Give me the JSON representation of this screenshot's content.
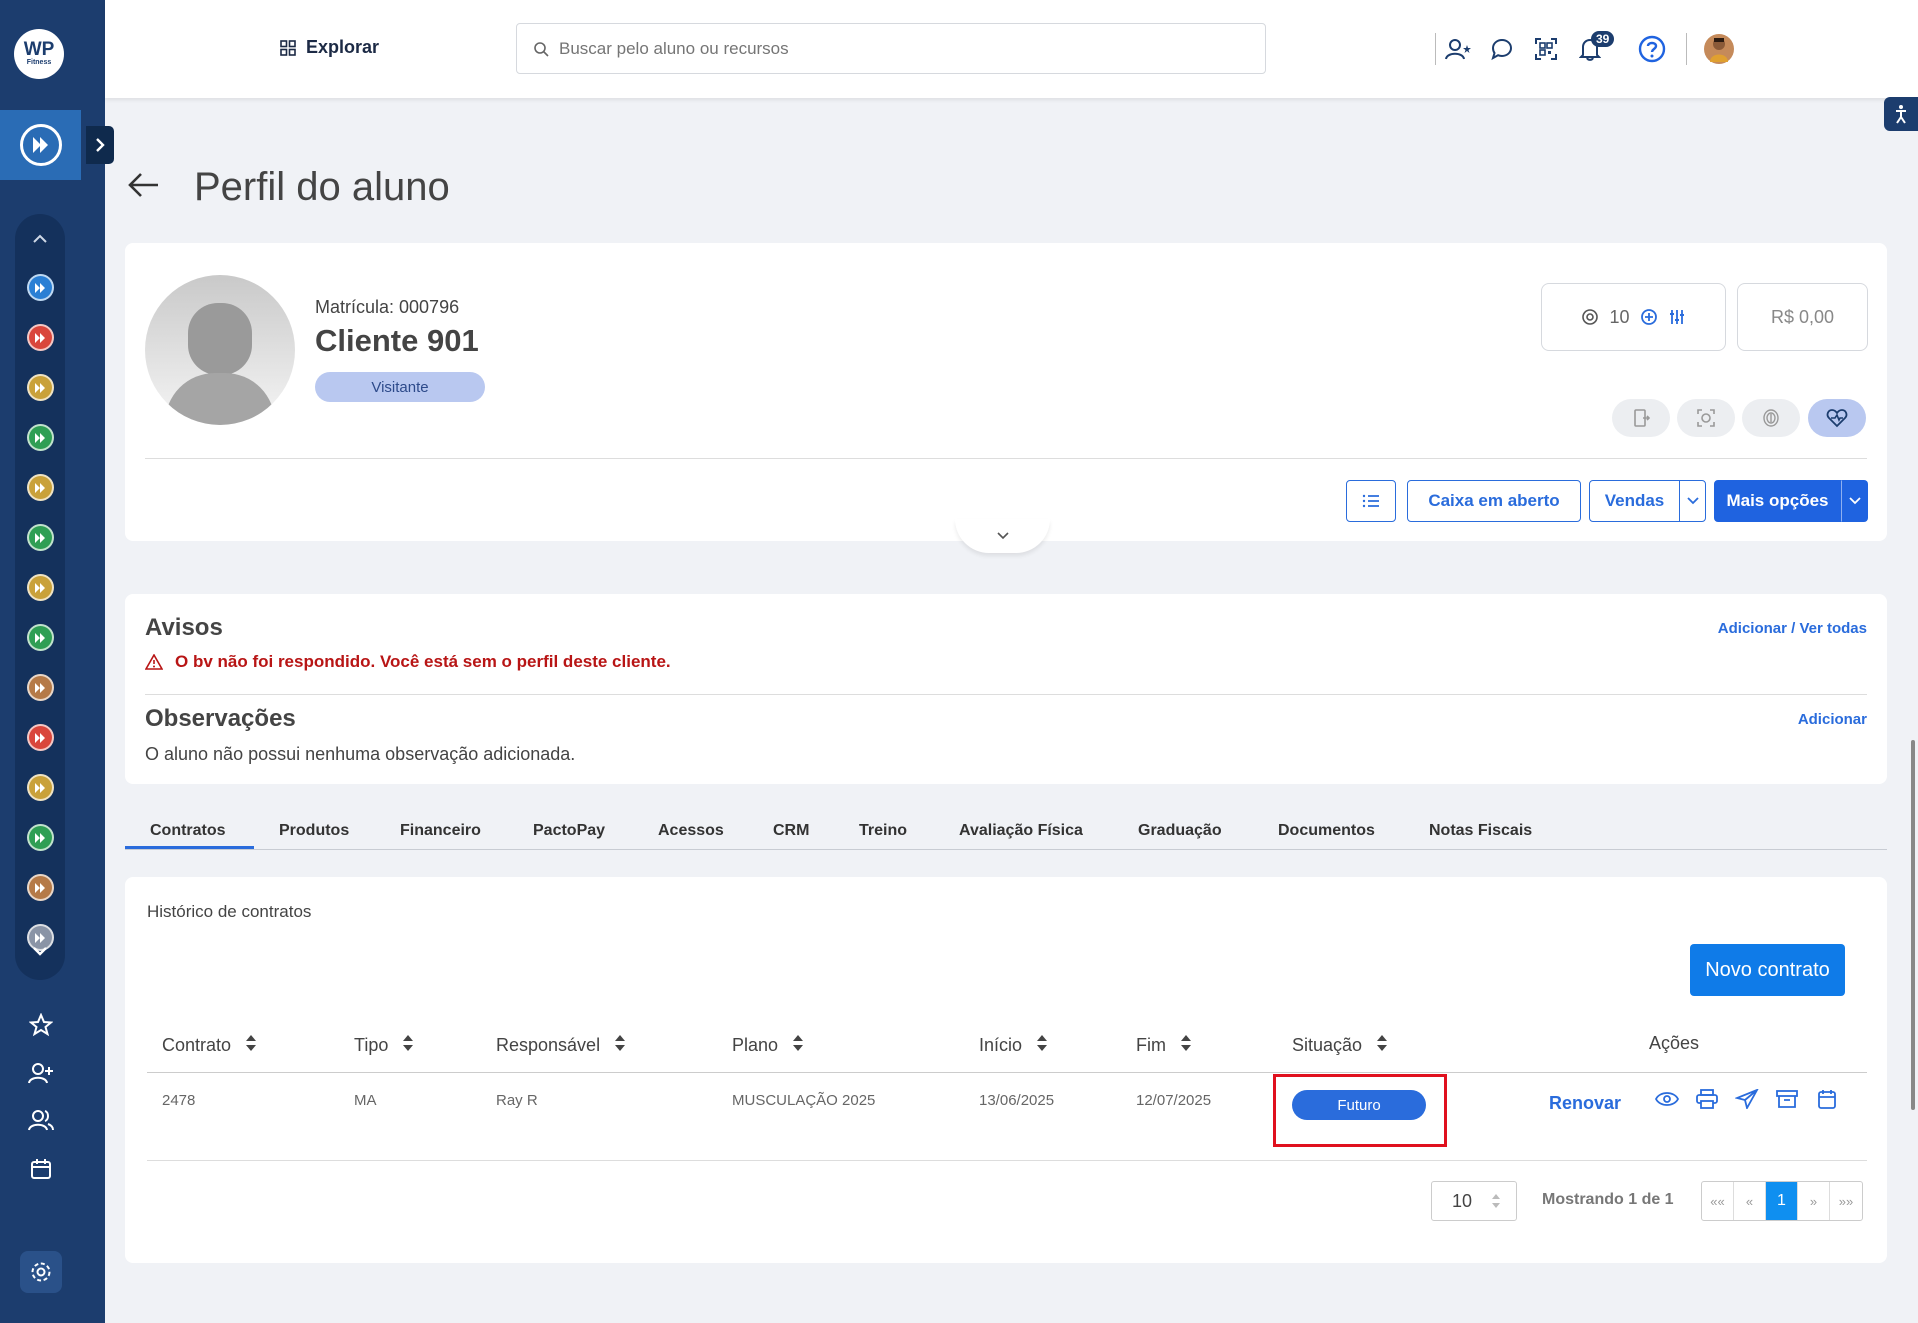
{
  "brand": {
    "logo_main": "WP",
    "logo_sub": "Fitness"
  },
  "colors": {
    "sidebar": "#1c3d6e",
    "accent": "#2a6cdc",
    "warning": "#b81515",
    "highlight": "#e0101e"
  },
  "sidebar": {
    "modules": [
      {
        "name": "module-1",
        "color": "#2a7fd4"
      },
      {
        "name": "module-2",
        "color": "#d9463c"
      },
      {
        "name": "module-3",
        "color": "#c9a13a"
      },
      {
        "name": "module-4",
        "color": "#2f9e54"
      },
      {
        "name": "module-5",
        "color": "#c9a13a"
      },
      {
        "name": "module-6",
        "color": "#2f9e54"
      },
      {
        "name": "module-7",
        "color": "#c9a13a"
      },
      {
        "name": "module-8",
        "color": "#2f9e54"
      },
      {
        "name": "module-9",
        "color": "#b57a48"
      },
      {
        "name": "module-10",
        "color": "#d9463c"
      },
      {
        "name": "module-11",
        "color": "#c9a13a"
      },
      {
        "name": "module-12",
        "color": "#2f9e54"
      },
      {
        "name": "module-13",
        "color": "#b57a48"
      },
      {
        "name": "module-14",
        "color": "#8a94a6"
      }
    ]
  },
  "header": {
    "explore_label": "Explorar",
    "search_placeholder": "Buscar pelo aluno ou recursos",
    "notifications_count": "39"
  },
  "page": {
    "title": "Perfil do aluno"
  },
  "profile": {
    "matricula": "Matrícula: 000796",
    "name": "Cliente 901",
    "status": "Visitante",
    "points": "10",
    "balance": "R$ 0,00",
    "buttons": {
      "caixa": "Caixa em aberto",
      "vendas": "Vendas",
      "mais": "Mais opções"
    }
  },
  "avisos": {
    "title": "Avisos",
    "link": "Adicionar / Ver todas",
    "message": "O bv não foi respondido. Você está sem o perfil deste cliente."
  },
  "observacoes": {
    "title": "Observações",
    "link": "Adicionar",
    "message": "O aluno não possui nenhuma observação adicionada."
  },
  "tabs": [
    "Contratos",
    "Produtos",
    "Financeiro",
    "PactoPay",
    "Acessos",
    "CRM",
    "Treino",
    "Avaliação Física",
    "Graduação",
    "Documentos",
    "Notas Fiscais"
  ],
  "contracts": {
    "section_title": "Histórico de contratos",
    "new_button": "Novo contrato",
    "columns": [
      "Contrato",
      "Tipo",
      "Responsável",
      "Plano",
      "Início",
      "Fim",
      "Situação",
      "Ações"
    ],
    "rows": [
      {
        "contrato": "2478",
        "tipo": "MA",
        "responsavel": "Ray R",
        "plano": "MUSCULAÇÃO 2025",
        "inicio": "13/06/2025",
        "fim": "12/07/2025",
        "situacao": "Futuro",
        "renovar": "Renovar"
      }
    ],
    "page_size": "10",
    "showing": "Mostrando 1 de 1",
    "pager": {
      "first": "««",
      "prev": "«",
      "current": "1",
      "next": "»",
      "last": "»»"
    }
  }
}
